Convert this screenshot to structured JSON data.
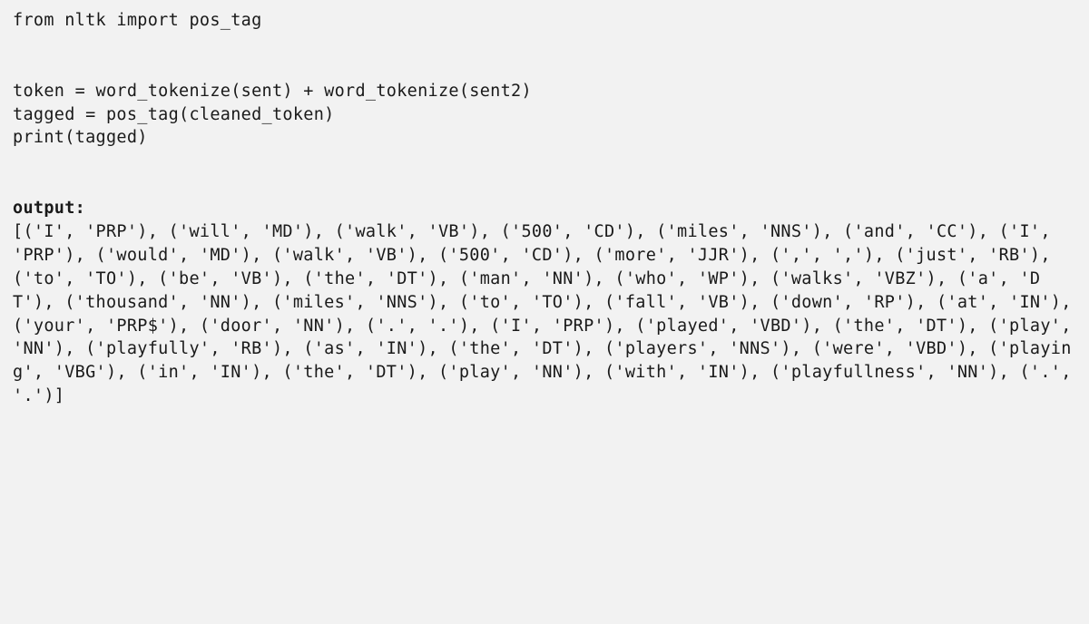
{
  "code": {
    "line1": "from nltk import pos_tag",
    "line2": "token = word_tokenize(sent) + word_tokenize(sent2)",
    "line3": "tagged = pos_tag(cleaned_token)",
    "line4": "print(tagged)"
  },
  "output_label": "output:",
  "output_text": "[('I', 'PRP'), ('will', 'MD'), ('walk', 'VB'), ('500', 'CD'), ('miles', 'NNS'), ('and', 'CC'), ('I', 'PRP'), ('would', 'MD'), ('walk', 'VB'), ('500', 'CD'), ('more', 'JJR'), (',', ','), ('just', 'RB'), ('to', 'TO'), ('be', 'VB'), ('the', 'DT'), ('man', 'NN'), ('who', 'WP'), ('walks', 'VBZ'), ('a', 'DT'), ('thousand', 'NN'), ('miles', 'NNS'), ('to', 'TO'), ('fall', 'VB'), ('down', 'RP'), ('at', 'IN'), ('your', 'PRP$'), ('door', 'NN'), ('.', '.'), ('I', 'PRP'), ('played', 'VBD'), ('the', 'DT'), ('play', 'NN'), ('playfully', 'RB'), ('as', 'IN'), ('the', 'DT'), ('players', 'NNS'), ('were', 'VBD'), ('playing', 'VBG'), ('in', 'IN'), ('the', 'DT'), ('play', 'NN'), ('with', 'IN'), ('playfullness', 'NN'), ('.', '.')]"
}
